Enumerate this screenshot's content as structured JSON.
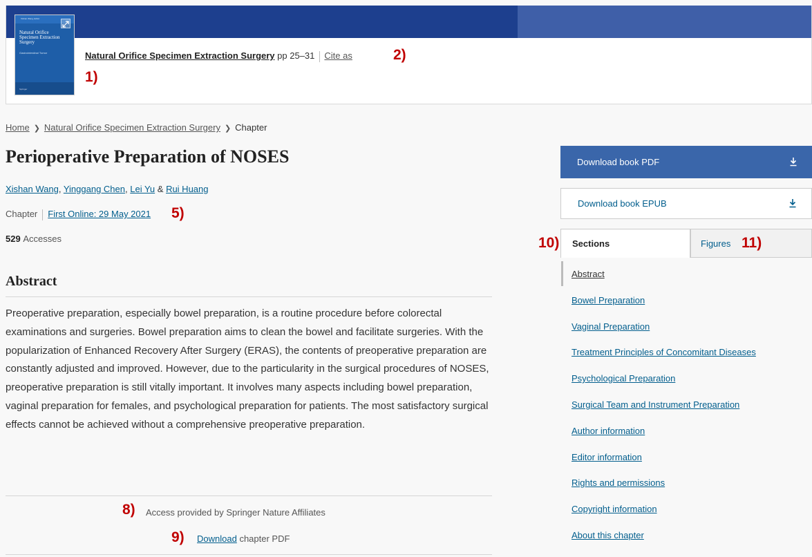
{
  "book_header": {
    "cover": {
      "small_text": "Xishan Wang, Editor",
      "title": "Natural Orifice Specimen Extraction Surgery",
      "subtitle": "Gastrointestinal Tumor",
      "footer": "Springer",
      "expand_icon": "expand-icon"
    },
    "book_title": "Natural Orifice Specimen Extraction Surgery",
    "pages": "pp 25–31",
    "cite_label": "Cite as",
    "colors": {
      "top_bar": "#1d3f8e",
      "top_bar_right": "#3f5fa8",
      "cover": "#1e5ea8"
    }
  },
  "annotations": {
    "m1": "1)",
    "m2": "2)",
    "m5": "5)",
    "m8": "8)",
    "m9": "9)",
    "m10": "10)",
    "m11": "11)",
    "color": "#c00000"
  },
  "breadcrumb": {
    "home": "Home",
    "book": "Natural Orifice Specimen Extraction Surgery",
    "current": "Chapter",
    "separator_icon": "chevron-right-icon"
  },
  "chapter": {
    "title": "Perioperative Preparation of NOSES",
    "authors": [
      "Xishan Wang",
      "Yinggang Chen",
      "Lei Yu",
      "Rui Huang"
    ],
    "author_sep_1": ", ",
    "author_sep_2": ", ",
    "author_sep_3": " & ",
    "type": "Chapter",
    "first_online": "First Online: 29 May 2021",
    "accesses_count": "529",
    "accesses_label": "Accesses"
  },
  "abstract": {
    "heading": "Abstract",
    "text": "Preoperative preparation, especially bowel preparation, is a routine procedure before colorectal examinations and surgeries. Bowel preparation aims to clean the bowel and facilitate surgeries. With the popularization of Enhanced Recovery After Surgery (ERAS), the contents of preoperative preparation are constantly adjusted and improved. However, due to the particularity in the surgical procedures of NOSES, preoperative preparation is still vitally important. It involves many aspects including bowel preparation, vaginal preparation for females, and psychological preparation for patients. The most satisfactory surgical effects cannot be achieved without a comprehensive preoperative preparation."
  },
  "access_box": {
    "access_text": "Access provided by Springer Nature Affiliates",
    "download_link": "Download",
    "download_suffix": " chapter PDF"
  },
  "sidebar": {
    "download_pdf": "Download book PDF",
    "download_epub": "Download book EPUB",
    "download_icon": "download-icon",
    "pdf_button_color": "#3a66aa",
    "tabs": {
      "sections": "Sections",
      "figures": "Figures"
    },
    "toc": [
      "Abstract",
      "Bowel Preparation",
      "Vaginal Preparation",
      "Treatment Principles of Concomitant Diseases",
      "Psychological Preparation",
      "Surgical Team and Instrument Preparation",
      "Author information",
      "Editor information",
      "Rights and permissions",
      "Copyright information",
      "About this chapter"
    ]
  }
}
